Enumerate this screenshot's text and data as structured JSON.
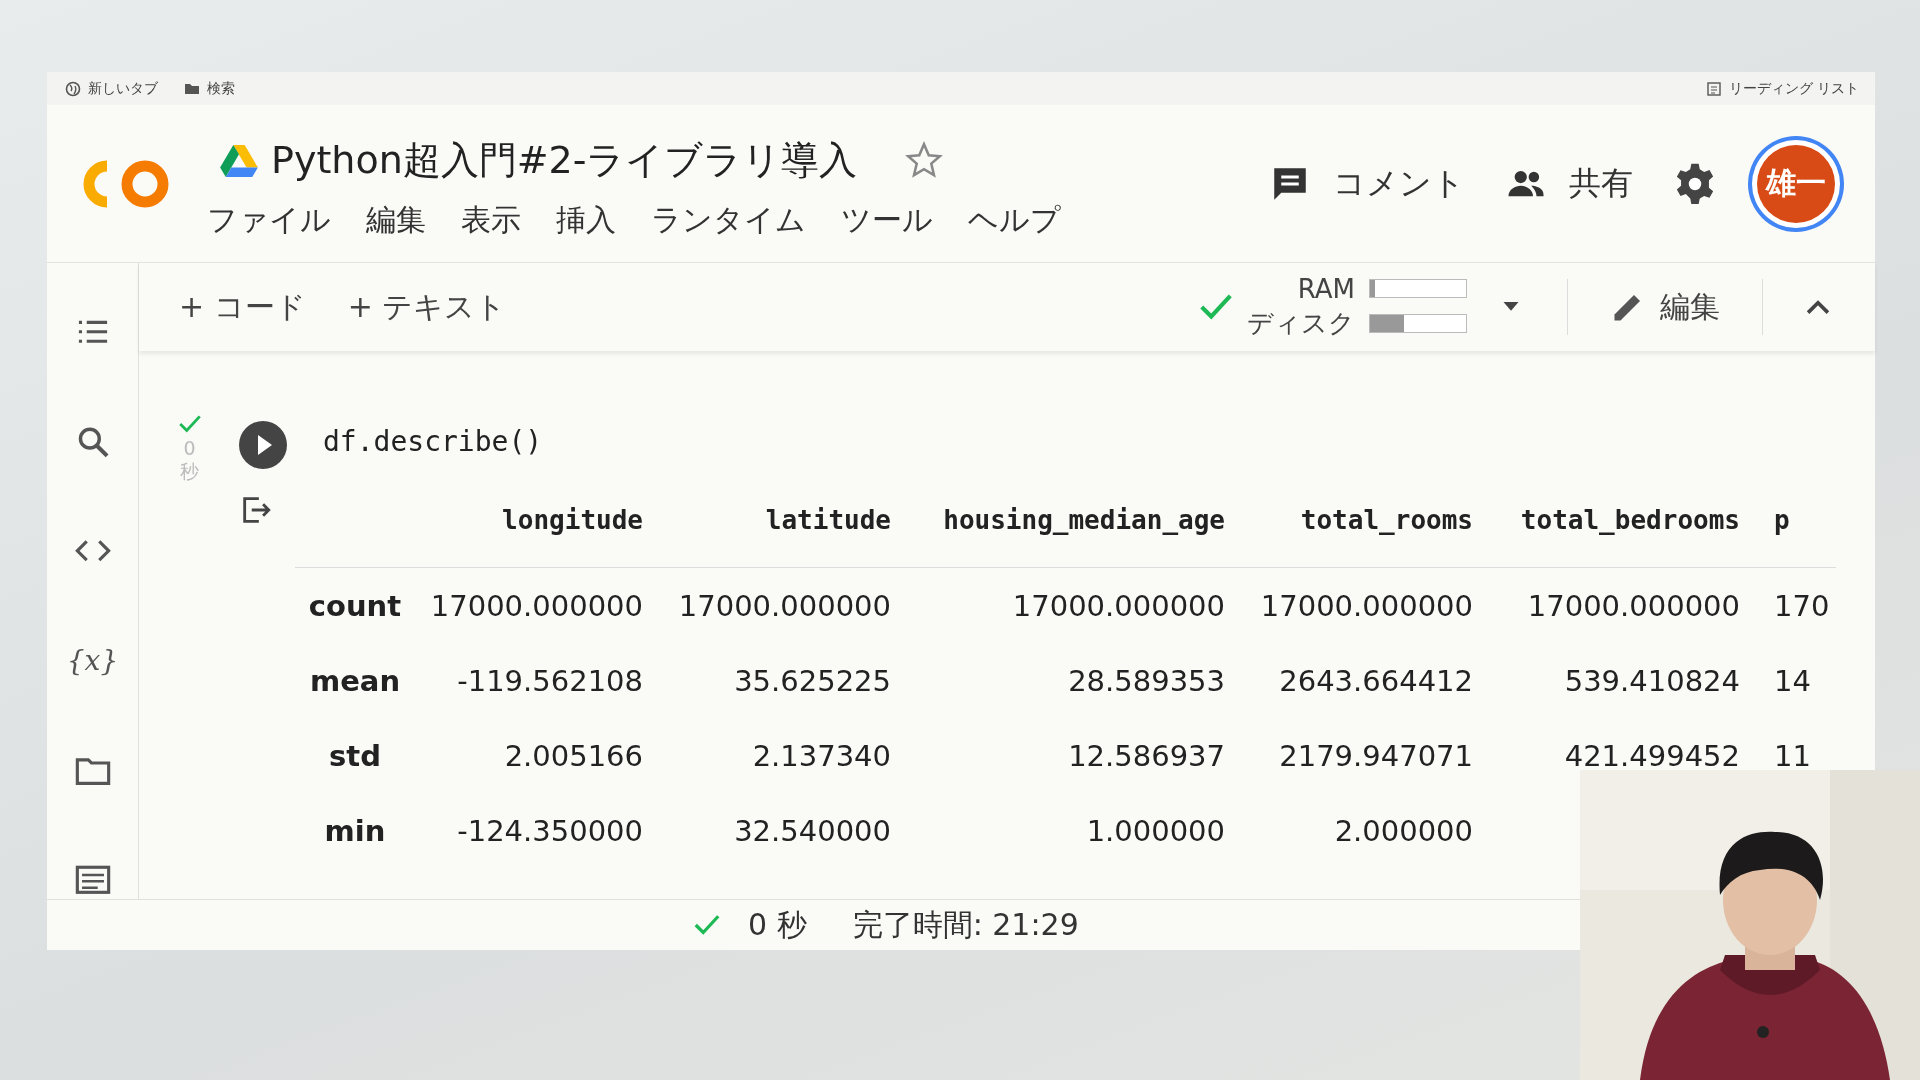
{
  "bookmarks": [
    {
      "kind": "globe",
      "label": "新しいタブ"
    },
    {
      "kind": "folder",
      "label": "検索"
    }
  ],
  "reading_list": "リーディング リスト",
  "notebook": {
    "title": "Python超入門#2-ライブラリ導入",
    "starred": false
  },
  "menu": [
    "ファイル",
    "編集",
    "表示",
    "挿入",
    "ランタイム",
    "ツール",
    "ヘルプ"
  ],
  "header_actions": {
    "comment": "コメント",
    "share": "共有",
    "avatar": "雄一"
  },
  "toolbar": {
    "add_code": "+ コード",
    "add_text": "+ テキスト",
    "ram_label": "RAM",
    "ram": {
      "level": 0.05
    },
    "disk_label": "ディスク",
    "disk": {
      "level": 0.35
    },
    "edit": "編集"
  },
  "sidebar": [
    {
      "kind": "toc"
    },
    {
      "kind": "search"
    },
    {
      "kind": "code"
    },
    {
      "kind": "variables",
      "label": "{x}"
    },
    {
      "kind": "folder"
    },
    {
      "kind": "terminal"
    }
  ],
  "cell": {
    "code": "df.describe()",
    "elapsed_value": "0",
    "elapsed_unit": "秒"
  },
  "table": {
    "columns": [
      "longitude",
      "latitude",
      "housing_median_age",
      "total_rooms",
      "total_bedrooms",
      "p"
    ],
    "rows": [
      {
        "label": "count",
        "cells": [
          "17000.000000",
          "17000.000000",
          "17000.000000",
          "17000.000000",
          "17000.000000",
          "170"
        ]
      },
      {
        "label": "mean",
        "cells": [
          "-119.562108",
          "35.625225",
          "28.589353",
          "2643.664412",
          "539.410824",
          "14"
        ]
      },
      {
        "label": "std",
        "cells": [
          "2.005166",
          "2.137340",
          "12.586937",
          "2179.947071",
          "421.499452",
          "11"
        ]
      },
      {
        "label": "min",
        "cells": [
          "-124.350000",
          "32.540000",
          "1.000000",
          "2.000000",
          "",
          ""
        ]
      }
    ]
  },
  "status_bar": {
    "duration": "0 秒",
    "finished": "完了時間: 21:29"
  }
}
